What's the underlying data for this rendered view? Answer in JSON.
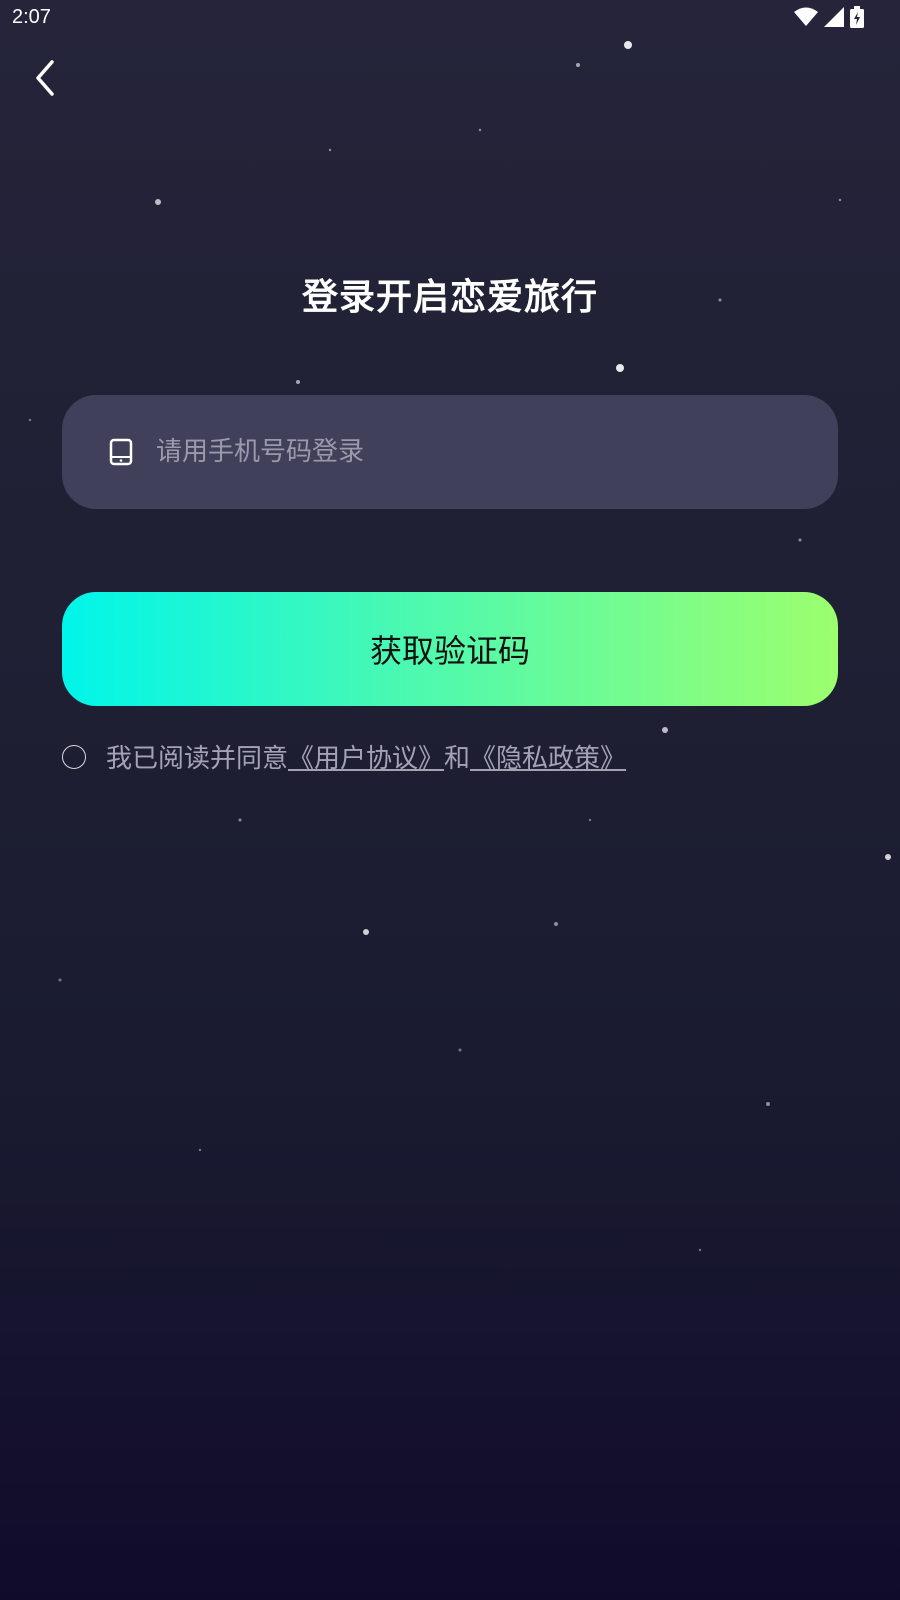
{
  "status_bar": {
    "time": "2:07",
    "icons": [
      "wifi-icon",
      "signal-icon",
      "battery-charging-icon"
    ]
  },
  "navigation": {
    "back_icon": "chevron-left-icon"
  },
  "title": "登录开启恋爱旅行",
  "phone_field": {
    "icon": "phone-icon",
    "placeholder": "请用手机号码登录",
    "value": ""
  },
  "get_code_button": {
    "label": "获取验证码"
  },
  "agreement": {
    "checked": false,
    "prefix": "我已阅读并同意",
    "user_agreement": "《用户协议》",
    "conjunction": "和",
    "privacy_policy": "《隐私政策》"
  },
  "colors": {
    "background_top": "#25243a",
    "background_bottom": "#110b2b",
    "field_bg": "#40405a",
    "button_gradient_start": "#00f5ea",
    "button_gradient_end": "#9cff6e",
    "muted_text": "#a3a3b5"
  }
}
